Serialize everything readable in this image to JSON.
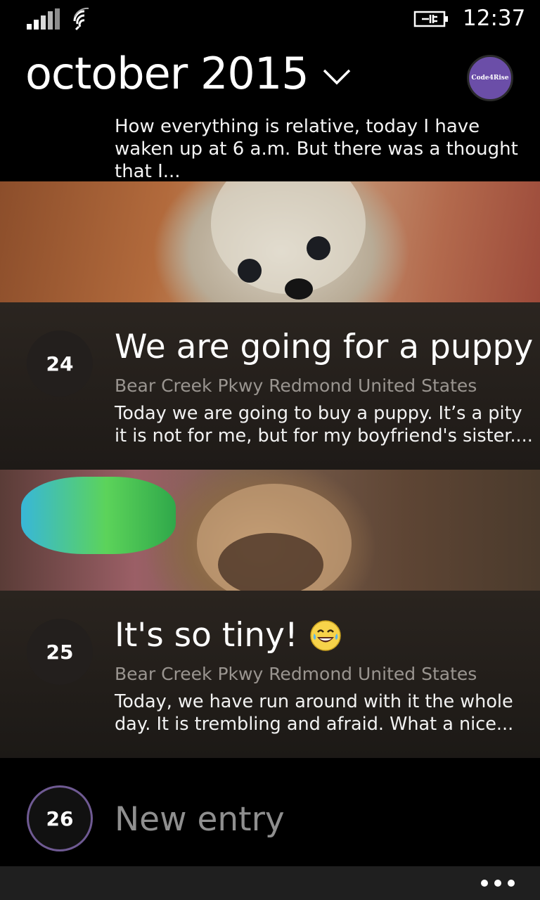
{
  "status_bar": {
    "time": "12:37",
    "icons": [
      "signal-bars-icon",
      "wifi-icon",
      "battery-charging-icon"
    ]
  },
  "header": {
    "title": "october 2015",
    "avatar_text": "Code4Rise"
  },
  "previous_entry": {
    "preview": "How everything is relative, today I have waken up at 6 a.m. But there was a thought that I..."
  },
  "entries": [
    {
      "day": "24",
      "title": "We are going for a puppy",
      "location": "Bear Creek Pkwy Redmond United States",
      "text": "Today we are going to buy a puppy. It’s a pity it is not for me, but for my boyfriend's sister...."
    },
    {
      "day": "25",
      "title": "It's so tiny!",
      "emoji": "laughing-tears-emoji-icon",
      "location": "Bear Creek Pkwy Redmond United States",
      "text": "Today, we have run around with it the whole day. It is trembling and afraid. What a nice..."
    }
  ],
  "new_entry": {
    "day": "26",
    "label": "New entry"
  },
  "app_bar": {
    "more_icon": "more-ellipsis-icon"
  },
  "colors": {
    "avatar": "#6b4ea8",
    "new_entry_ring": "#6f5a93",
    "app_bar": "#1f1f1f"
  }
}
